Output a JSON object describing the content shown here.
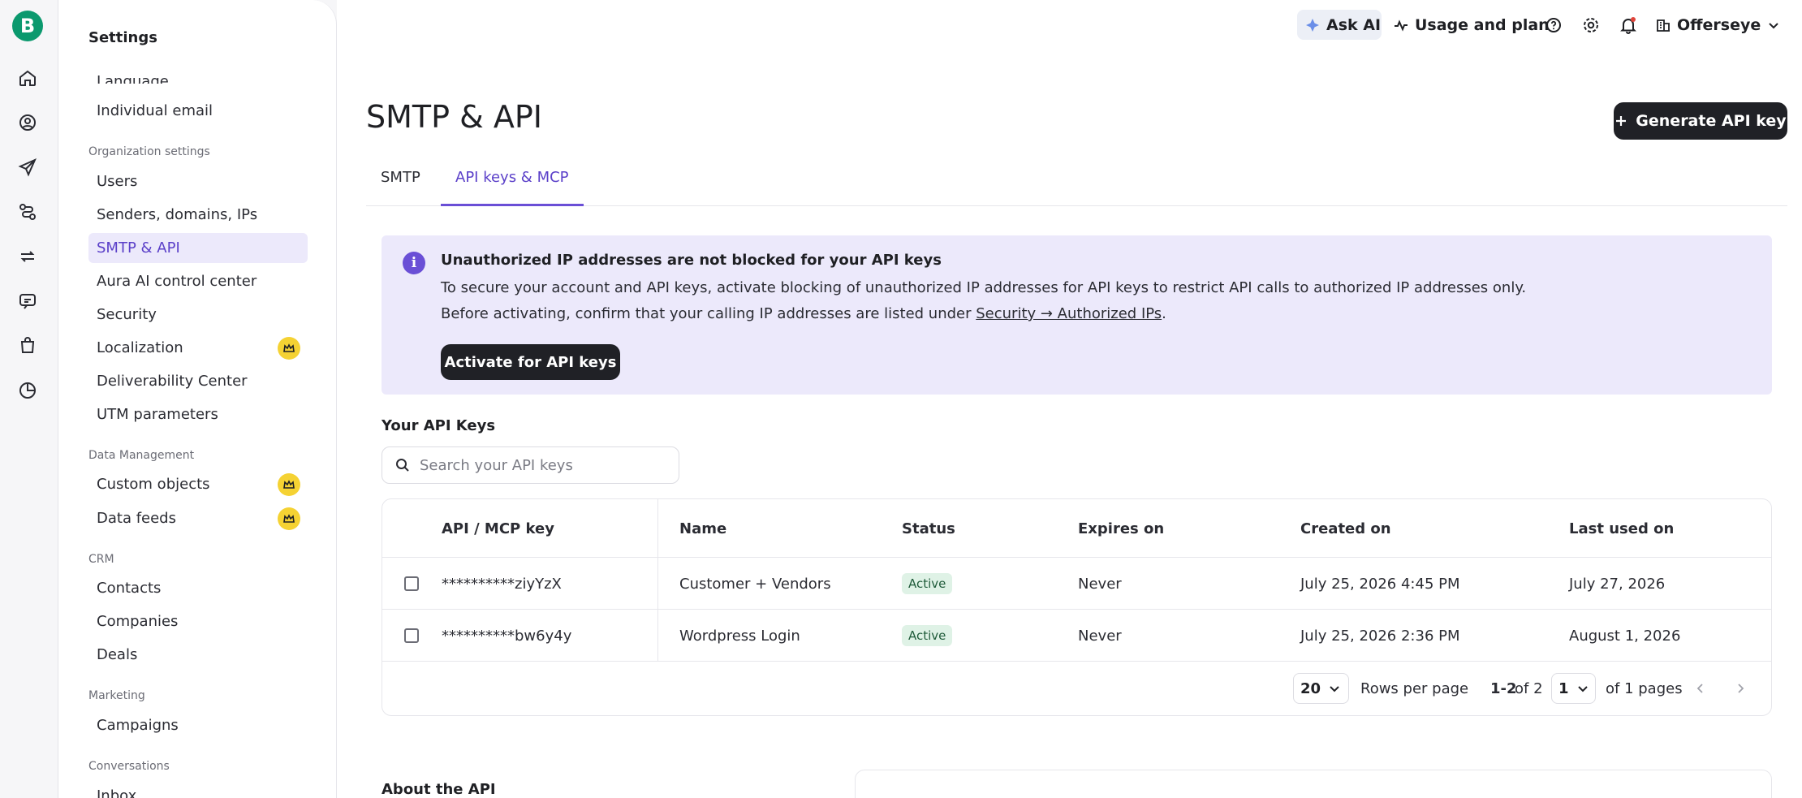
{
  "rail": {
    "logo": "B",
    "icons": [
      "home-icon",
      "contacts-icon",
      "campaigns-icon",
      "automations-icon",
      "transactional-icon",
      "conversations-icon",
      "ecommerce-icon",
      "reports-icon"
    ]
  },
  "sidebar": {
    "title": "Settings",
    "partial_item": "Language",
    "items_top": [
      {
        "label": "Individual email"
      }
    ],
    "org_section": "Organization settings",
    "org_items": [
      {
        "label": "Users"
      },
      {
        "label": "Senders, domains, IPs"
      },
      {
        "label": "SMTP & API"
      },
      {
        "label": "Aura AI control center"
      },
      {
        "label": "Security"
      },
      {
        "label": "Localization"
      },
      {
        "label": "Deliverability Center"
      },
      {
        "label": "UTM parameters"
      }
    ],
    "data_section": "Data Management",
    "data_items": [
      {
        "label": "Custom objects"
      },
      {
        "label": "Data feeds"
      }
    ],
    "crm_section": "CRM",
    "crm_items": [
      {
        "label": "Contacts"
      },
      {
        "label": "Companies"
      },
      {
        "label": "Deals"
      }
    ],
    "marketing_section": "Marketing",
    "marketing_items": [
      {
        "label": "Campaigns"
      }
    ],
    "conversations_section": "Conversations",
    "conversations_items": [
      {
        "label": "Inbox"
      }
    ]
  },
  "topbar": {
    "ask_ai": "Ask AI",
    "usage": "Usage and plan",
    "account": "Offerseye"
  },
  "page": {
    "title": "SMTP & API",
    "generate_button": "Generate API key",
    "tabs": [
      {
        "label": "SMTP"
      },
      {
        "label": "API keys & MCP"
      }
    ],
    "active_tab": "API keys & MCP"
  },
  "alert": {
    "title": "Unauthorized IP addresses are not blocked for your API keys",
    "line1": "To secure your account and API keys, activate blocking of unauthorized IP addresses for API keys to restrict API calls to authorized IP addresses only.",
    "line2_prefix": "Before activating, confirm that your calling IP addresses are listed under ",
    "line2_link": "Security → Authorized IPs",
    "line2_suffix": ".",
    "button": "Activate for API keys"
  },
  "keys": {
    "title": "Your API Keys",
    "search_placeholder": "Search your API keys",
    "columns": [
      "API / MCP key",
      "Name",
      "Status",
      "Expires on",
      "Created on",
      "Last used on"
    ],
    "rows": [
      {
        "key": "**********ziyYzX",
        "name": "Customer + Vendors",
        "status": "Active",
        "expires": "Never",
        "created": "July 25, 2026 4:45 PM",
        "last_used": "July 27, 2026"
      },
      {
        "key": "**********bw6y4y",
        "name": "Wordpress Login",
        "status": "Active",
        "expires": "Never",
        "created": "July 25, 2026 2:36 PM",
        "last_used": "August 1, 2026"
      }
    ],
    "pagination": {
      "rows_per_page_value": "20",
      "rows_per_page_label": "Rows per page",
      "range": "1-2",
      "of_total": "of 2",
      "page_value": "1",
      "of_pages": "of 1 pages"
    }
  },
  "about": {
    "title": "About the API"
  },
  "colors": {
    "accent": "#6a4fd6",
    "brand": "#0b996e",
    "alert_bg": "#ece9fb",
    "badge_bg": "#dff2e6",
    "crown": "#f5d233"
  }
}
